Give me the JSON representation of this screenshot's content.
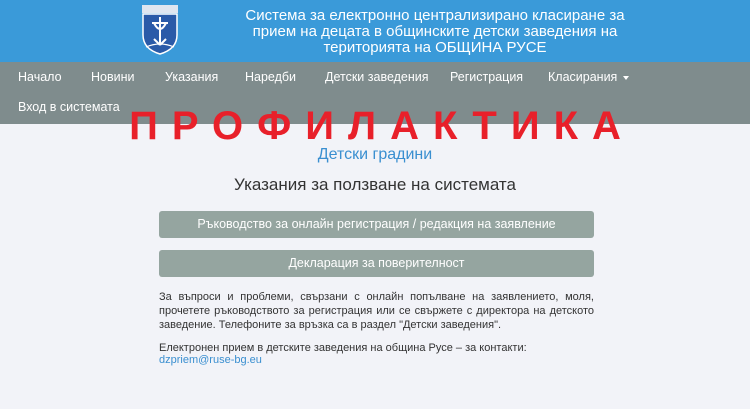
{
  "header": {
    "title_lines": [
      "Система за електронно централизирано класиране за",
      "прием на децата в общинските детски заведения на",
      "територията на ОБЩИНА РУСЕ"
    ]
  },
  "nav": {
    "items": [
      {
        "label": "Начало"
      },
      {
        "label": "Новини"
      },
      {
        "label": "Указания"
      },
      {
        "label": "Наредби"
      },
      {
        "label": "Детски заведения"
      },
      {
        "label": "Регистрация"
      },
      {
        "label": "Класирания"
      },
      {
        "label": "Вход в системата"
      }
    ]
  },
  "banner": "ПРОФИЛАКТИКА",
  "subtitle": "Детски градини",
  "page_title": "Указания за ползване на системата",
  "buttons": {
    "guide": "Ръководство за онлайн регистрация / редакция на заявление",
    "privacy": "Декларация за поверителност"
  },
  "info_text": "За въпроси и проблеми, свързани с онлайн попълване на заявлението, моля, прочетете ръководството за регистрация или се свържете с директора на детското заведение. Телефоните за връзка са в раздел \"Детски заведения\".",
  "contact": {
    "text": "Електронен прием в детските заведения на община Русе – за контакти: ",
    "email": "dzpriem@ruse-bg.eu"
  },
  "colors": {
    "header_bg": "#3a9ad9",
    "nav_bg": "#7f8c8d",
    "banner": "#e8202a",
    "accent": "#3a8fd0",
    "button_bg": "#95a5a0"
  }
}
